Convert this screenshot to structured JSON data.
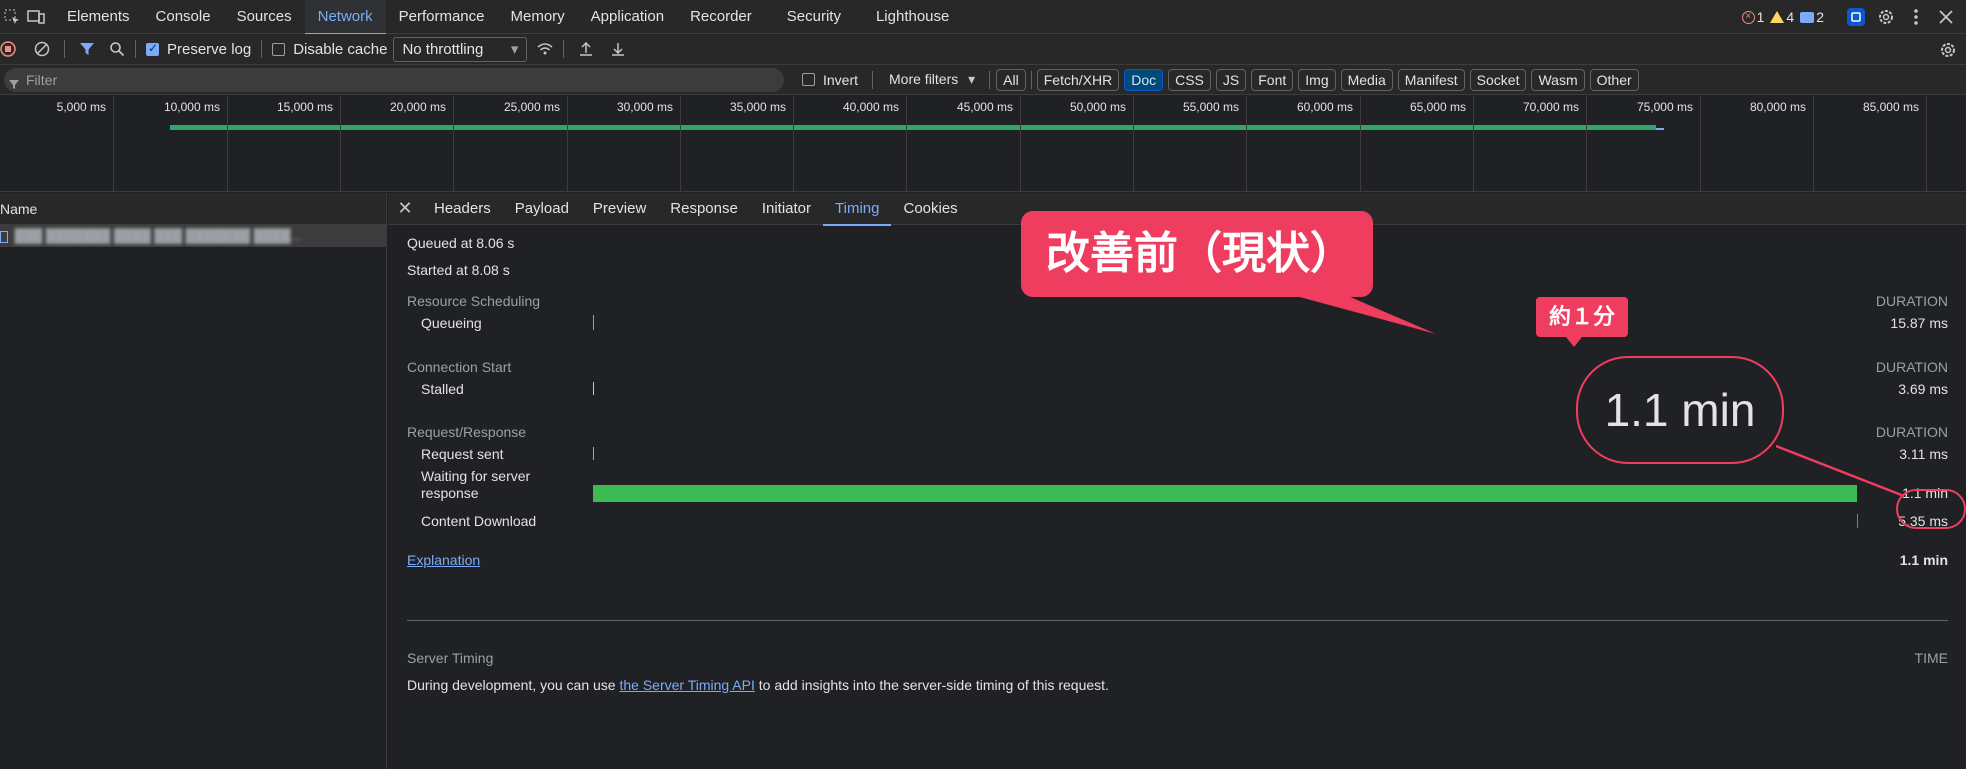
{
  "devtools": {
    "tabs": [
      "Elements",
      "Console",
      "Sources",
      "Network",
      "Performance",
      "Memory",
      "Application",
      "Recorder",
      "Security",
      "Lighthouse"
    ],
    "active_tab": "Network",
    "errors": "1",
    "warnings": "4",
    "messages": "2"
  },
  "toolbar": {
    "preserve_log": "Preserve log",
    "disable_cache": "Disable cache",
    "throttling": "No throttling"
  },
  "filterbar": {
    "placeholder": "Filter",
    "invert": "Invert",
    "more_filters": "More filters",
    "types": [
      "All",
      "Fetch/XHR",
      "Doc",
      "CSS",
      "JS",
      "Font",
      "Img",
      "Media",
      "Manifest",
      "Socket",
      "Wasm",
      "Other"
    ],
    "active_type": "Doc"
  },
  "overview": {
    "ticks": [
      "5,000 ms",
      "10,000 ms",
      "15,000 ms",
      "20,000 ms",
      "25,000 ms",
      "30,000 ms",
      "35,000 ms",
      "40,000 ms",
      "45,000 ms",
      "50,000 ms",
      "55,000 ms",
      "60,000 ms",
      "65,000 ms",
      "70,000 ms",
      "75,000 ms",
      "80,000 ms",
      "85,000 ms"
    ]
  },
  "requests": {
    "column_name": "Name",
    "rows": [
      "███ ███████ ████ ███ ███████ ████..."
    ]
  },
  "detail": {
    "tabs": [
      "Headers",
      "Payload",
      "Preview",
      "Response",
      "Initiator",
      "Timing",
      "Cookies"
    ],
    "active_tab": "Timing",
    "queued": "Queued at 8.06 s",
    "started": "Started at 8.08 s",
    "sections": {
      "resource_scheduling": "Resource Scheduling",
      "connection_start": "Connection Start",
      "request_response": "Request/Response",
      "duration": "DURATION"
    },
    "rows": {
      "queueing": {
        "label": "Queueing",
        "value": "15.87 ms"
      },
      "stalled": {
        "label": "Stalled",
        "value": "3.69 ms"
      },
      "request_sent": {
        "label": "Request sent",
        "value": "3.11 ms"
      },
      "waiting": {
        "label": "Waiting for server response",
        "value": "1.1 min"
      },
      "download": {
        "label": "Content Download",
        "value": "5.35 ms"
      }
    },
    "explanation": "Explanation",
    "total": "1.1 min",
    "server_timing": {
      "title": "Server Timing",
      "time": "TIME",
      "text_before": "During development, you can use ",
      "link": "the Server Timing API",
      "text_after": " to add insights into the server-side timing of this request."
    }
  },
  "annotations": {
    "callout": "改善前（現状）",
    "note": "約１分",
    "big_value": "1.1 min"
  },
  "colors": {
    "accent": "#7cacf8",
    "bar_green": "#3cba54",
    "annotation": "#ef3d5f"
  }
}
